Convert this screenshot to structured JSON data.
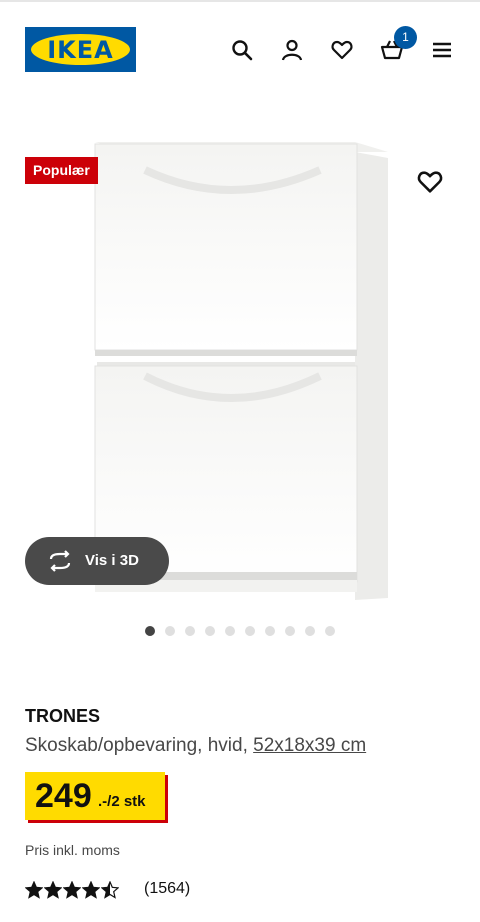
{
  "header": {
    "logo_text": "IKEA",
    "cart_count": "1",
    "icons": [
      "search-icon",
      "account-icon",
      "heart-icon",
      "basket-icon",
      "menu-icon"
    ]
  },
  "gallery": {
    "promo_badge": "Populær",
    "view_3d_label": "Vis i 3D",
    "image_count": 10,
    "active_index": 0
  },
  "product": {
    "name": "TRONES",
    "description": "Skoskab/opbevaring, hvid, ",
    "dimensions": "52x18x39 cm",
    "price_main": "249",
    "price_suffix": ".-/2 stk",
    "vat_note": "Pris inkl. moms",
    "rating_value": 4.5,
    "review_count": "(1564)"
  },
  "colors": {
    "brand_blue": "#0058a3",
    "brand_yellow": "#ffdb00",
    "promo_red": "#cc0008"
  }
}
